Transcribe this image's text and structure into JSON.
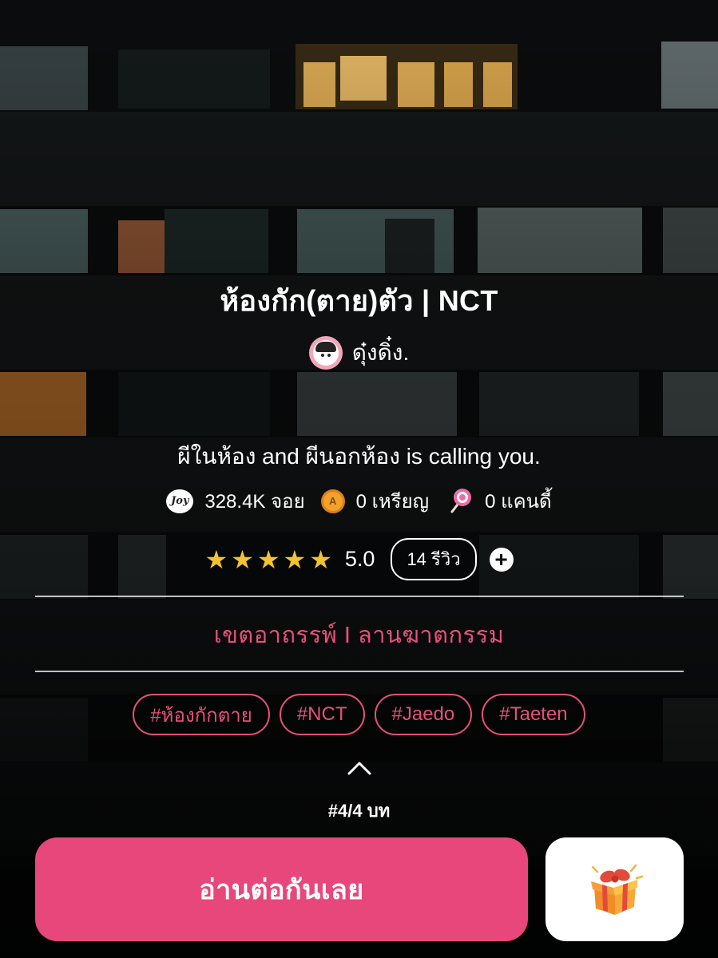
{
  "novel": {
    "title": "ห้องกัก(ตาย)ตัว | NCT",
    "author": "ดุ๋งดิ๋ง.",
    "tagline": "ผีในห้อง and ผีนอกห้อง is calling you."
  },
  "stats": {
    "joy_icon_text": "Joy",
    "coin_icon_text": "A",
    "views": "328.4K จอย",
    "coins": "0 เหรียญ",
    "candy": "0 แคนดี้"
  },
  "rating": {
    "stars": 5,
    "score": "5.0",
    "reviews": "14 รีวิว",
    "add_symbol": "+"
  },
  "genre": "เขตอาถรรพ์ I ลานฆาตกรรม",
  "tags": [
    "#ห้องกักตาย",
    "#NCT",
    "#Jaedo",
    "#Taeten"
  ],
  "episode": "#4/4 บท",
  "actions": {
    "read_label": "อ่านต่อกันเลย"
  },
  "icons": {
    "views": "joy-icon",
    "coins": "coin-icon",
    "candy": "lollipop-icon",
    "gift": "gift-box-icon",
    "expand": "chevron-up-icon"
  },
  "colors": {
    "accent": "#e8477b",
    "star": "#f2c230",
    "background": "#0d0f10"
  }
}
